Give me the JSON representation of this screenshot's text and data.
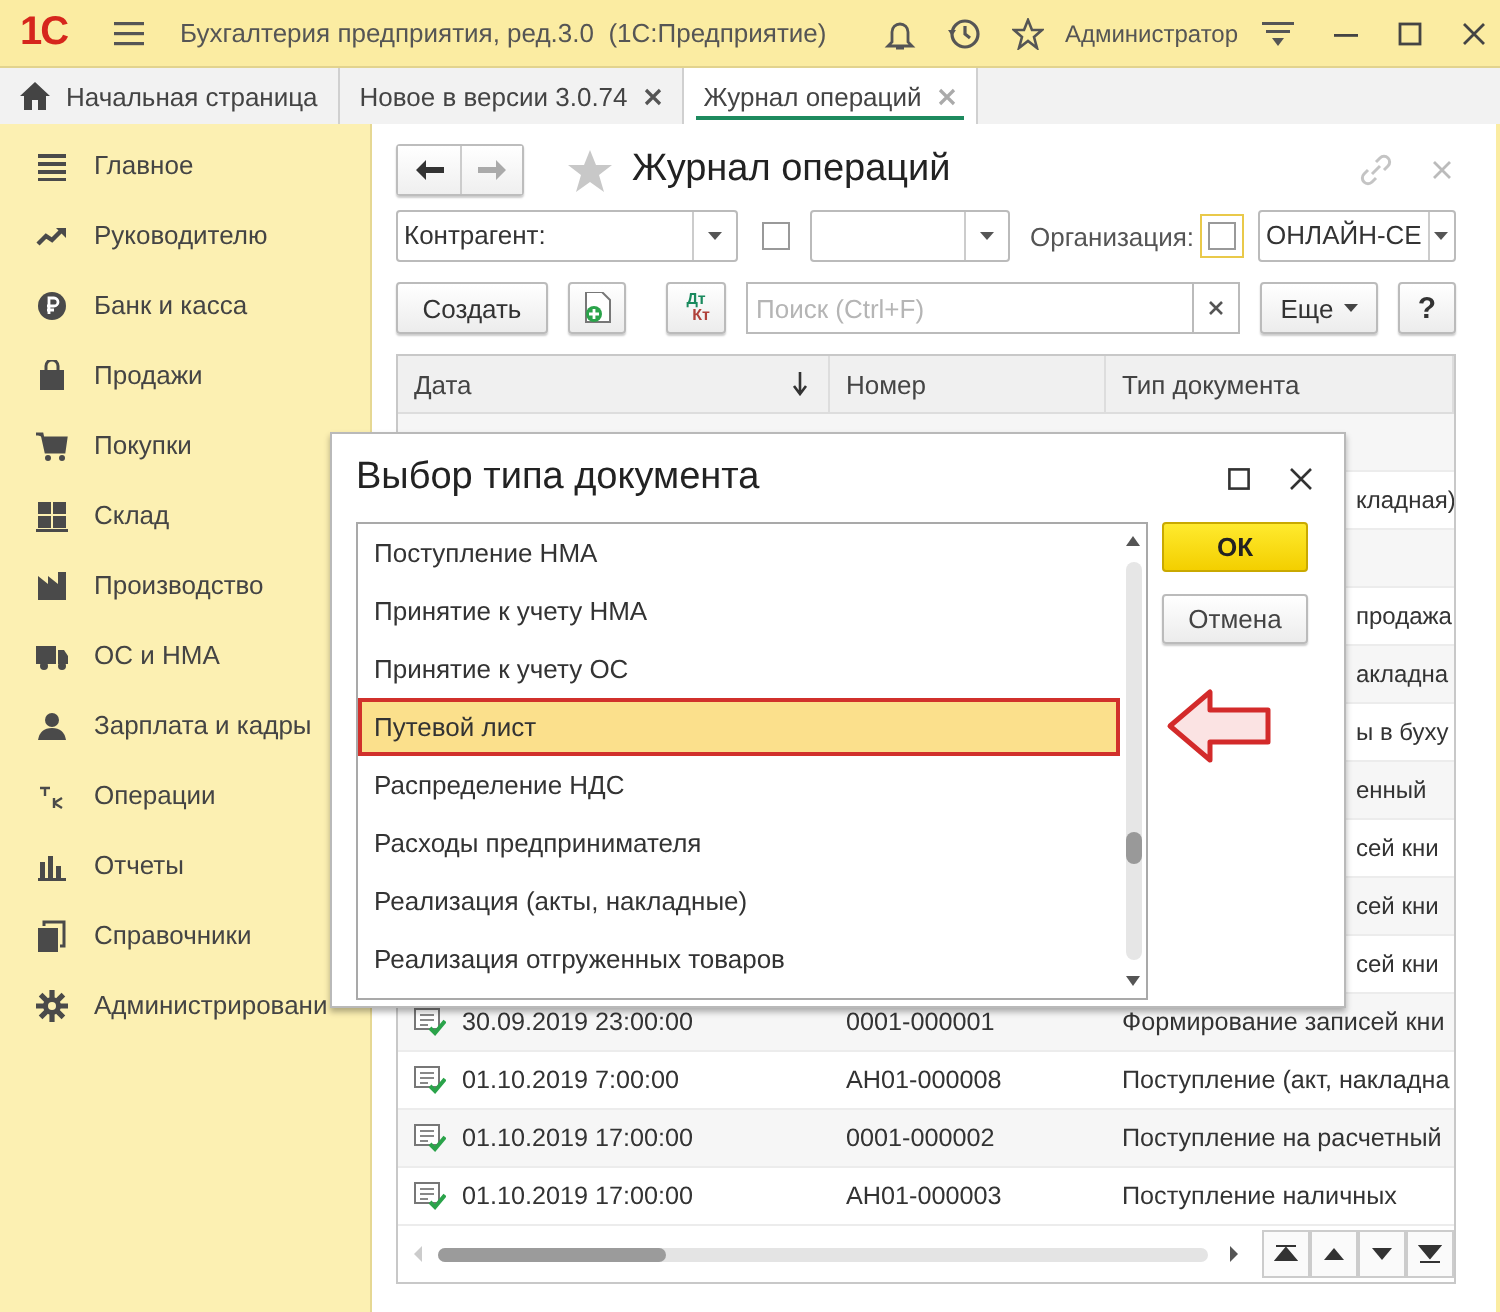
{
  "window": {
    "logo": "1С",
    "title": "Бухгалтерия предприятия, ред.3.0  (1С:Предприятие)",
    "user": "Администратор"
  },
  "tabs": [
    {
      "label": "Начальная страница",
      "kind": "home",
      "selected": false
    },
    {
      "label": "Новое в версии 3.0.74",
      "kind": "page",
      "selected": false
    },
    {
      "label": "Журнал операций",
      "kind": "page",
      "selected": true
    }
  ],
  "sidebar": {
    "items": [
      {
        "label": "Главное",
        "kind": "menu"
      },
      {
        "label": "Руководителю",
        "kind": "trend"
      },
      {
        "label": "Банк и касса",
        "kind": "ruble"
      },
      {
        "label": "Продажи",
        "kind": "bag"
      },
      {
        "label": "Покупки",
        "kind": "cart"
      },
      {
        "label": "Склад",
        "kind": "grid"
      },
      {
        "label": "Производство",
        "kind": "factory"
      },
      {
        "label": "ОС и НМА",
        "kind": "truck"
      },
      {
        "label": "Зарплата и кадры",
        "kind": "person"
      },
      {
        "label": "Операции",
        "kind": "ledger"
      },
      {
        "label": "Отчеты",
        "kind": "bars"
      },
      {
        "label": "Справочники",
        "kind": "books"
      },
      {
        "label": "Администрировани",
        "kind": "gear"
      }
    ]
  },
  "journal": {
    "title": "Журнал операций",
    "counterparty": {
      "value": "Контрагент:"
    },
    "filter_checkbox": {
      "checked": false
    },
    "organization": {
      "label": "Организация:",
      "checked": false,
      "focused": true,
      "value": "ОНЛАЙН-СЕ"
    },
    "create_button": "Создать",
    "dt_kt": [
      "Дт",
      "Кт"
    ],
    "search": {
      "placeholder": "Поиск (Ctrl+F)"
    },
    "more_button": "Еще",
    "help_button": "?"
  },
  "table": {
    "columns": [
      {
        "label": "Дата",
        "sorted": true
      },
      {
        "label": "Номер",
        "sorted": false
      },
      {
        "label": "Тип документа",
        "sorted": false
      }
    ],
    "rows": [
      {
        "covered": true
      },
      {
        "covered": true,
        "type": "кладная)"
      },
      {
        "covered": true
      },
      {
        "covered": true,
        "type": "продажа"
      },
      {
        "covered": true,
        "type": "акладна"
      },
      {
        "covered": true,
        "type": "ы в буху"
      },
      {
        "covered": true,
        "type": "енный"
      },
      {
        "covered": true,
        "type": "сей кни"
      },
      {
        "covered": true,
        "type": "сей кни"
      },
      {
        "covered": true,
        "type": "сей кни"
      },
      {
        "covered": false,
        "posted": true,
        "date": "30.09.2019 23:00:00",
        "number": "0001-000001",
        "type": "Формирование записей кни"
      },
      {
        "covered": false,
        "posted": true,
        "date": "01.10.2019 7:00:00",
        "number": "АН01-000008",
        "type": "Поступление (акт, накладна"
      },
      {
        "covered": false,
        "posted": true,
        "date": "01.10.2019 17:00:00",
        "number": "0001-000002",
        "type": "Поступление на расчетный"
      },
      {
        "covered": false,
        "posted": true,
        "date": "01.10.2019 17:00:00",
        "number": "АН01-000003",
        "type": "Поступление наличных"
      }
    ]
  },
  "dialog": {
    "title": "Выбор типа документа",
    "items": [
      {
        "label": "Поступление НМА",
        "selected": false
      },
      {
        "label": "Принятие к учету НМА",
        "selected": false
      },
      {
        "label": "Принятие к учету ОС",
        "selected": false
      },
      {
        "label": "Путевой лист",
        "selected": true
      },
      {
        "label": "Распределение НДС",
        "selected": false
      },
      {
        "label": "Расходы предпринимателя",
        "selected": false
      },
      {
        "label": "Реализация (акты, накладные)",
        "selected": false
      },
      {
        "label": "Реализация отгруженных товаров",
        "selected": false
      }
    ],
    "buttons": [
      {
        "label": "ОК",
        "kind": "default"
      },
      {
        "label": "Отмена",
        "kind": "normal"
      }
    ]
  }
}
